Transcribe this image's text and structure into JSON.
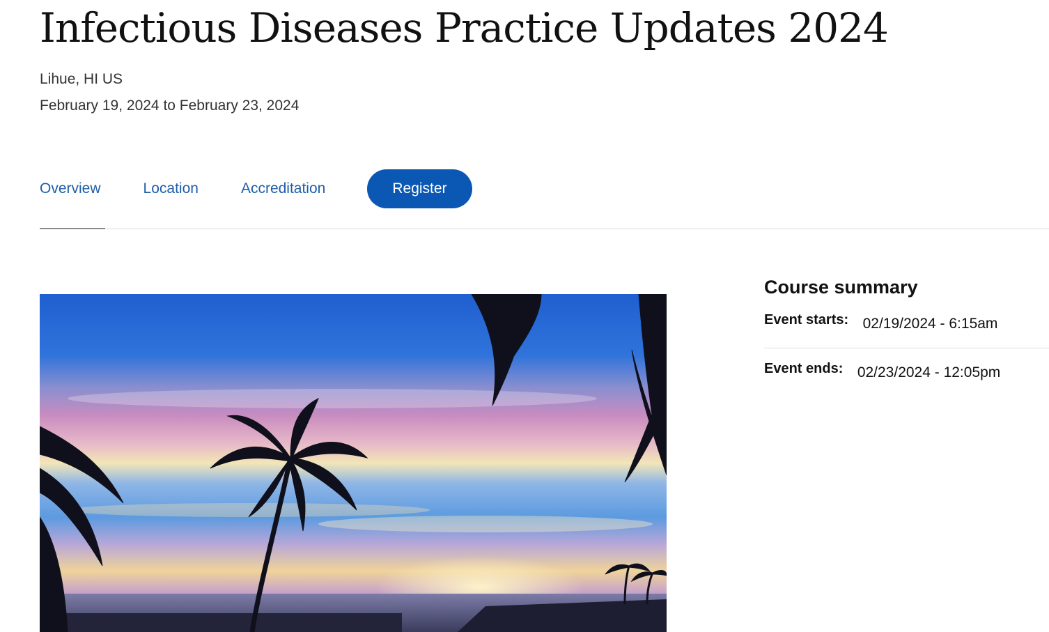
{
  "page": {
    "title": "Infectious Diseases Practice Updates 2024",
    "location": "Lihue, HI US",
    "dates": "February 19, 2024 to February 23, 2024"
  },
  "nav": {
    "tabs": [
      {
        "label": "Overview",
        "active": true
      },
      {
        "label": "Location",
        "active": false
      },
      {
        "label": "Accreditation",
        "active": false
      }
    ],
    "register_label": "Register"
  },
  "hero": {
    "image": "tropical-beach-sunset-with-palm-trees"
  },
  "summary": {
    "title": "Course summary",
    "start_label": "Event starts:",
    "start_value": "02/19/2024 - 6:15am",
    "end_label": "Event ends:",
    "end_value": "02/23/2024 - 12:05pm"
  },
  "colors": {
    "link": "#1f5da8",
    "button": "#0b57b4",
    "button_text": "#ffffff",
    "divider": "#d9d9d9"
  }
}
